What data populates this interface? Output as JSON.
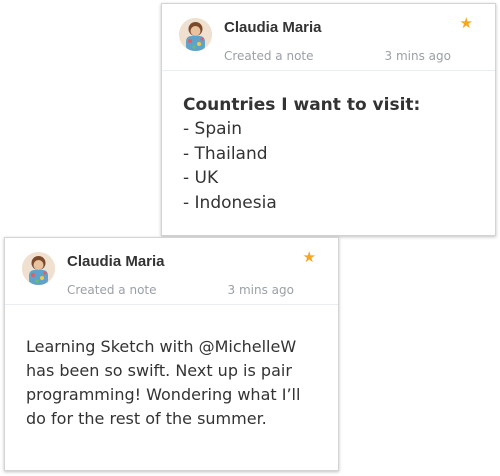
{
  "notes": [
    {
      "author": "Claudia Maria",
      "action": "Created a note",
      "time": "3 mins ago",
      "starred": true,
      "title": "Countries I want to visit:",
      "items": [
        "- Spain",
        "- Thailand",
        "- UK",
        "- Indonesia"
      ]
    },
    {
      "author": "Claudia Maria",
      "action": "Created a note",
      "time": "3 mins ago",
      "starred": true,
      "text": "Learning Sketch with @MichelleW has been so swift. Next up is pair programming! Wondering what I’ll do for the rest of the summer."
    }
  ],
  "colors": {
    "star": "#f5a623",
    "author": "#333333",
    "meta": "#9aa0a6",
    "card_border": "#d4d4d4"
  },
  "icons": {
    "star": "star-icon",
    "avatar": "user-avatar"
  }
}
